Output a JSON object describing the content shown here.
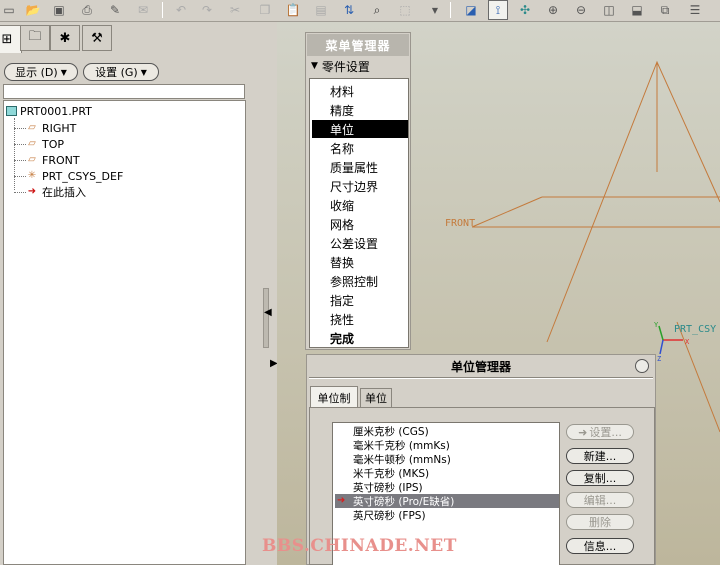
{
  "toolbar": {
    "icons": [
      "new-icon",
      "open-icon",
      "save-icon",
      "print-icon",
      "send-icon",
      "mail-icon",
      "undo-icon",
      "redo-icon",
      "cut-icon",
      "copy-icon",
      "paste-icon",
      "paste-special-icon",
      "regenerate-icon",
      "find-icon",
      "select-box-icon",
      "dropdown-icon",
      "sketch-icon",
      "datum-display-icon",
      "spin-center-icon",
      "zoom-in-icon",
      "zoom-out-icon",
      "refit-icon",
      "orient-icon",
      "view-manager-icon",
      "layers-icon"
    ]
  },
  "left_panel": {
    "show_button": "显示 (D)",
    "settings_button": "设置 (G)",
    "tree": [
      {
        "label": "PRT0001.PRT",
        "icon": "part-icon"
      },
      {
        "label": "RIGHT",
        "icon": "datum-plane-icon"
      },
      {
        "label": "TOP",
        "icon": "datum-plane-icon"
      },
      {
        "label": "FRONT",
        "icon": "datum-plane-icon"
      },
      {
        "label": "PRT_CSYS_DEF",
        "icon": "csys-icon"
      },
      {
        "label": "在此插入",
        "icon": "insert-here-arrow-icon"
      }
    ]
  },
  "viewport": {
    "front_label": "FRONT",
    "csys_label": "PRT_CSY",
    "axis_x": "X",
    "axis_y": "Y",
    "axis_z": "Z"
  },
  "menu_manager": {
    "title": "菜单管理器",
    "section": "零件设置",
    "items": [
      "材料",
      "精度",
      "单位",
      "名称",
      "质量属性",
      "尺寸边界",
      "收缩",
      "网格",
      "公差设置",
      "替换",
      "参照控制",
      "指定",
      "挠性",
      "完成"
    ],
    "selected": "单位",
    "bold_item": "完成"
  },
  "unit_manager": {
    "title": "单位管理器",
    "tabs": [
      "单位制",
      "单位"
    ],
    "active_tab": "单位制",
    "systems": [
      "厘米克秒 (CGS)",
      "毫米千克秒 (mmKs)",
      "毫米牛顿秒 (mmNs)",
      "米千克秒 (MKS)",
      "英寸磅秒 (IPS)",
      "英寸磅秒 (Pro/E缺省)",
      "英尺磅秒 (FPS)"
    ],
    "selected_system": "英寸磅秒 (Pro/E缺省)",
    "buttons": {
      "set": "设置...",
      "new": "新建...",
      "copy": "复制...",
      "edit": "编辑...",
      "delete": "删除",
      "info": "信息..."
    }
  },
  "watermark": "BBS.CHINADE.NET",
  "colors": {
    "datum_line": "#c47a3c",
    "csys_x": "#e03030",
    "csys_y": "#2aa02a",
    "csys_z": "#3050d0",
    "csys_label": "#2a8a8a",
    "insert_arrow": "#cc1010"
  }
}
